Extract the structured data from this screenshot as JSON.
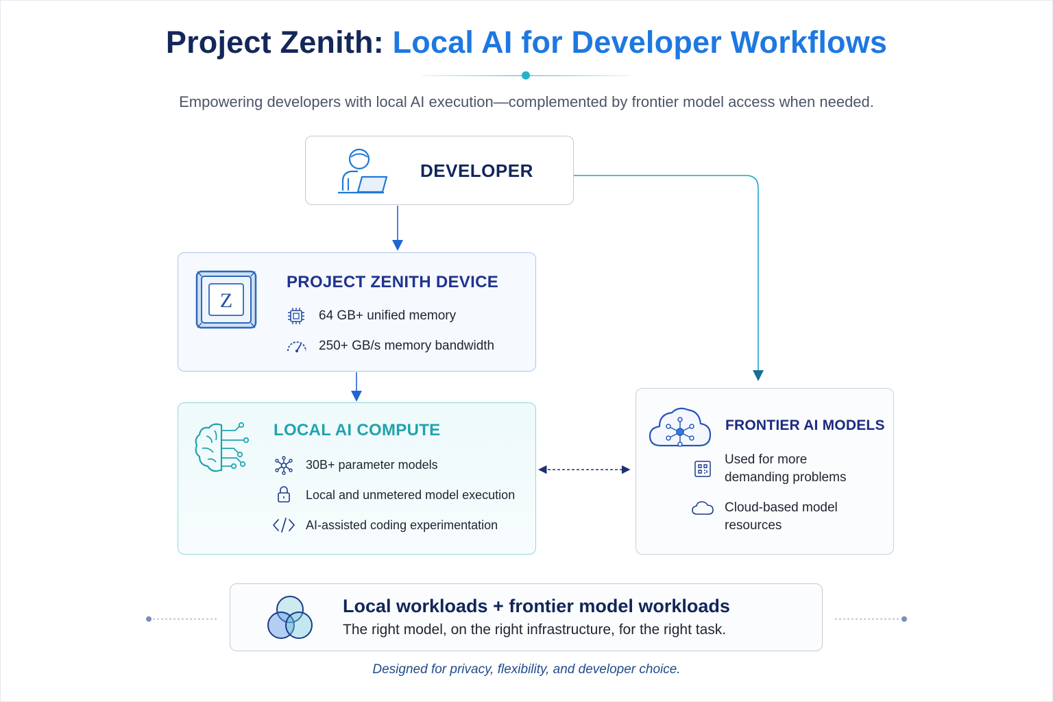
{
  "header": {
    "title_part1": "Project Zenith:",
    "title_part2": "Local AI for Developer Workflows",
    "subtitle": "Empowering developers with local AI execution—complemented by frontier model access when needed."
  },
  "developer": {
    "label": "DEVELOPER",
    "icon": "developer-laptop-icon"
  },
  "device": {
    "title": "PROJECT ZENITH DEVICE",
    "chip_letter": "Z",
    "specs": [
      {
        "icon": "chip-icon",
        "text": "64 GB+ unified memory"
      },
      {
        "icon": "gauge-icon",
        "text": "250+ GB/s memory bandwidth"
      }
    ]
  },
  "local_compute": {
    "title": "LOCAL AI COMPUTE",
    "icon": "brain-circuit-icon",
    "items": [
      {
        "icon": "network-icon",
        "text": "30B+ parameter models"
      },
      {
        "icon": "lock-icon",
        "text": "Local and unmetered model execution"
      },
      {
        "icon": "code-icon",
        "text": "AI-assisted coding experimentation"
      }
    ]
  },
  "frontier": {
    "title": "FRONTIER AI MODELS",
    "icon": "cloud-network-icon",
    "items": [
      {
        "icon": "scan-icon",
        "line1": "Used for more",
        "line2": "demanding problems"
      },
      {
        "icon": "cloud-icon",
        "line1": "Cloud-based model",
        "line2": "resources"
      }
    ]
  },
  "summary": {
    "title": "Local workloads + frontier model workloads",
    "subtitle": "The right model, on the right infrastructure, for the right task.",
    "icon": "venn-diagram-icon"
  },
  "footer": {
    "tagline": "Designed for privacy, flexibility, and developer choice."
  },
  "colors": {
    "navy": "#14275a",
    "blue_accent": "#1e78e0",
    "teal_accent": "#1fa3ad",
    "device_border": "#a9c6ea",
    "local_border": "#8fd9de"
  }
}
